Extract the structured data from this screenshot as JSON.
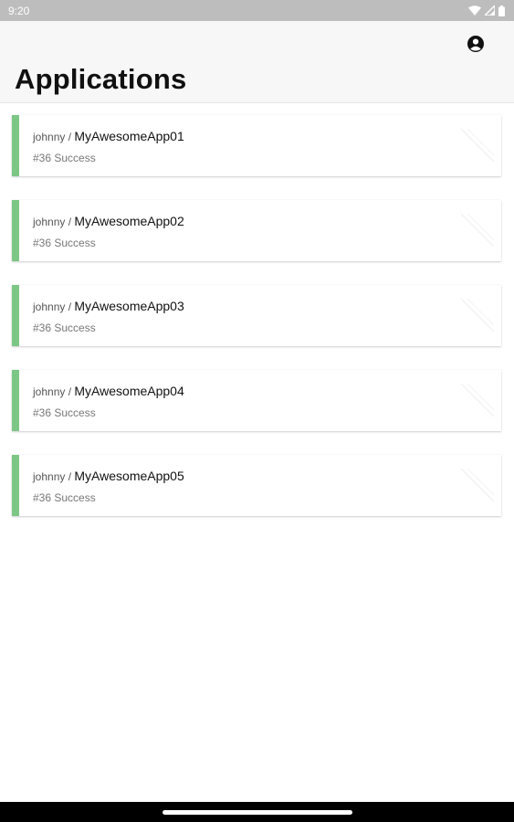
{
  "status_bar": {
    "time": "9:20",
    "icons": [
      "wifi-icon",
      "cell-signal-icon",
      "battery-icon"
    ]
  },
  "header": {
    "title": "Applications",
    "account_icon": "account-circle-icon"
  },
  "applications": [
    {
      "owner": "johnny",
      "separator": " / ",
      "name": "MyAwesomeApp01",
      "status": "#36 Success"
    },
    {
      "owner": "johnny",
      "separator": " / ",
      "name": "MyAwesomeApp02",
      "status": "#36 Success"
    },
    {
      "owner": "johnny",
      "separator": " / ",
      "name": "MyAwesomeApp03",
      "status": "#36 Success"
    },
    {
      "owner": "johnny",
      "separator": " / ",
      "name": "MyAwesomeApp04",
      "status": "#36 Success"
    },
    {
      "owner": "johnny",
      "separator": " / ",
      "name": "MyAwesomeApp05",
      "status": "#36 Success"
    }
  ],
  "colors": {
    "success_accent": "#7cc785",
    "status_bar": "#bdbdbd",
    "app_bar": "#f7f7f7"
  }
}
